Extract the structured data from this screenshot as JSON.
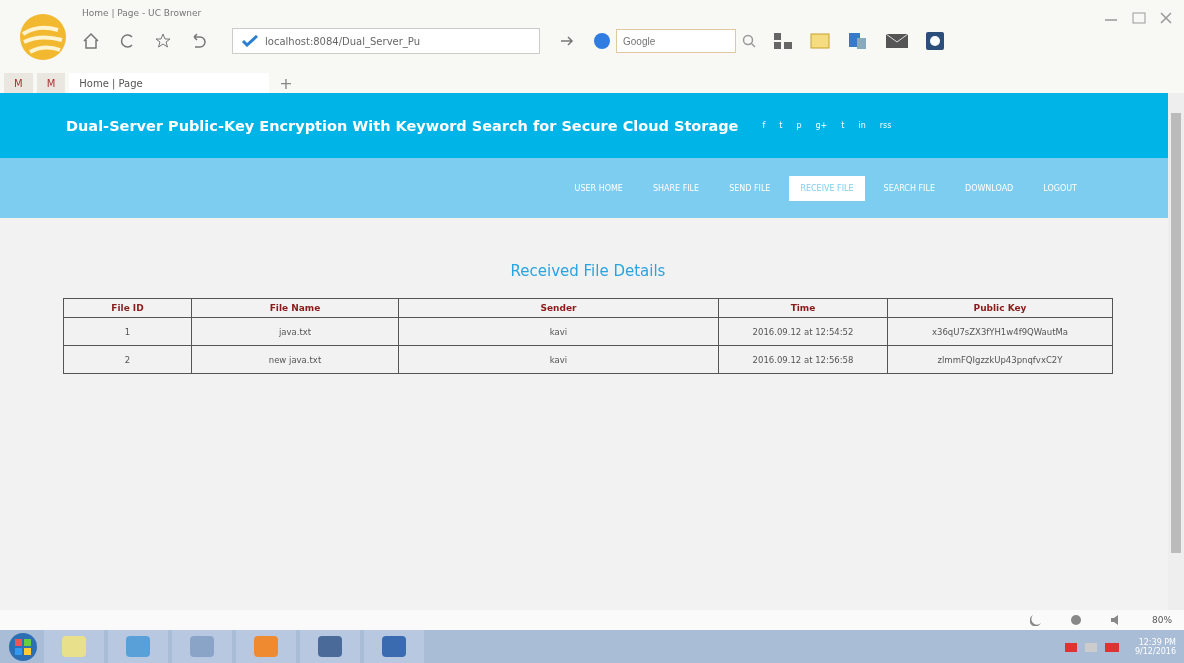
{
  "window": {
    "title": "Home | Page - UC Browner"
  },
  "toolbar": {
    "address": "localhost:8084/Dual_Server_Pu",
    "search_placeholder": "Google"
  },
  "tabs": [
    {
      "label": "M",
      "kind": "mail",
      "selected": false
    },
    {
      "label": "M",
      "kind": "mail",
      "selected": false
    },
    {
      "label": "Home | Page",
      "kind": "page",
      "selected": true
    }
  ],
  "new_tab": "+",
  "header": {
    "title": "Dual-Server Public-Key Encryption With Keyword Search for Secure Cloud Storage",
    "social": [
      "f",
      "t",
      "p",
      "g+",
      "t",
      "in",
      "rss"
    ]
  },
  "nav": [
    {
      "label": "USER HOME",
      "selected": false
    },
    {
      "label": "SHARE FILE",
      "selected": false
    },
    {
      "label": "SEND FILE",
      "selected": false
    },
    {
      "label": "RECEIVE FILE",
      "selected": true
    },
    {
      "label": "SEARCH FILE",
      "selected": false
    },
    {
      "label": "DOWNLOAD",
      "selected": false
    },
    {
      "label": "LOGOUT",
      "selected": false
    }
  ],
  "section_title": "Received File Details",
  "table": {
    "columns": [
      "File ID",
      "File Name",
      "Sender",
      "Time",
      "Public Key"
    ],
    "rows": [
      [
        "1",
        "java.txt",
        "kavi",
        "2016.09.12 at 12:54:52",
        "x36qU7sZX3fYH1w4f9QWautMa"
      ],
      [
        "2",
        "new java.txt",
        "kavi",
        "2016.09.12 at 12:56:58",
        "zlmmFQIgzzkUp43pnqfvxC2Y"
      ]
    ]
  },
  "status_bar": {
    "zoom": "80%"
  },
  "taskbar": {
    "time": "12:39 PM",
    "date": "9/12/2016"
  }
}
